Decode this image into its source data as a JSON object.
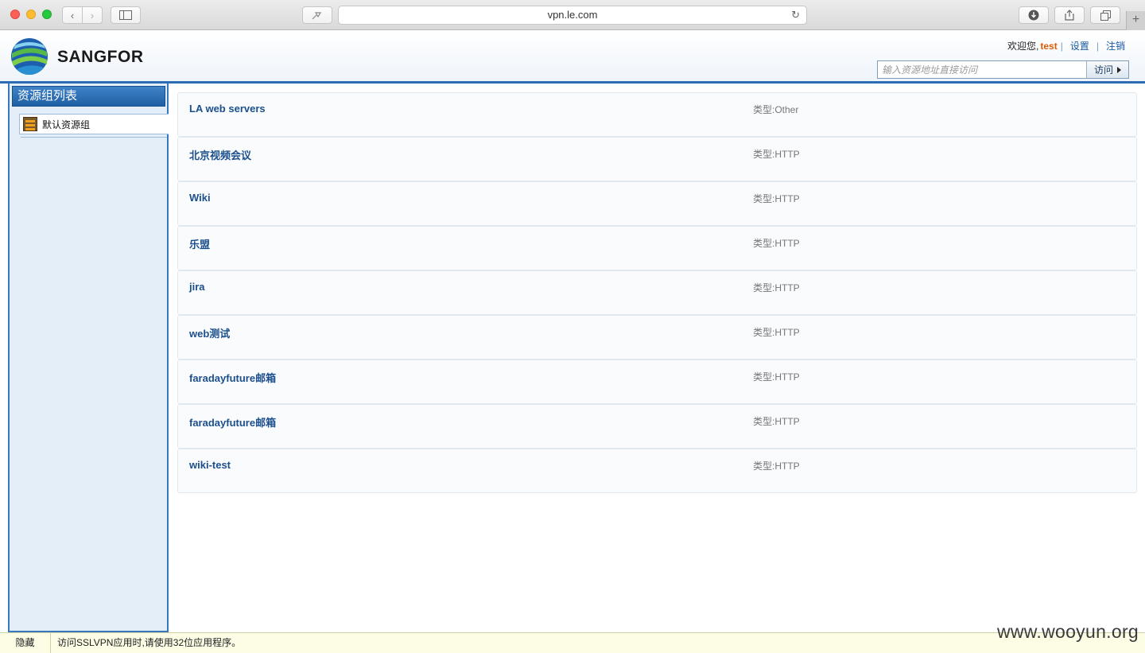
{
  "browser": {
    "url": "vpn.le.com"
  },
  "header": {
    "brand": "SANGFOR",
    "welcome": "欢迎您,",
    "username": "test",
    "settings": "设置",
    "logout": "注销",
    "visit_placeholder": "输入资源地址直接访问",
    "visit_label": "访问"
  },
  "sidebar": {
    "title": "资源组列表",
    "groups": [
      {
        "label": "默认资源组"
      }
    ]
  },
  "resources": [
    {
      "name": "LA web servers",
      "type": "类型:Other"
    },
    {
      "name": "北京视频会议",
      "type": "类型:HTTP"
    },
    {
      "name": "Wiki",
      "type": "类型:HTTP"
    },
    {
      "name": "乐盟",
      "type": "类型:HTTP"
    },
    {
      "name": "jira",
      "type": "类型:HTTP"
    },
    {
      "name": "web测试",
      "type": "类型:HTTP"
    },
    {
      "name": "faradayfuture邮箱",
      "type": "类型:HTTP"
    },
    {
      "name": "faradayfuture邮箱",
      "type": "类型:HTTP"
    },
    {
      "name": "wiki-test",
      "type": "类型:HTTP"
    }
  ],
  "statusbar": {
    "hide": "隐藏",
    "message": "访问SSLVPN应用时,请使用32位应用程序。"
  },
  "watermark": "www.wooyun.org",
  "colors": {
    "accent": "#2c6cb3",
    "username": "#e05a00",
    "link": "#1c4f8c"
  },
  "icons": {
    "logo": "sangfor-globe-logo",
    "group": "resource-group-icon"
  }
}
